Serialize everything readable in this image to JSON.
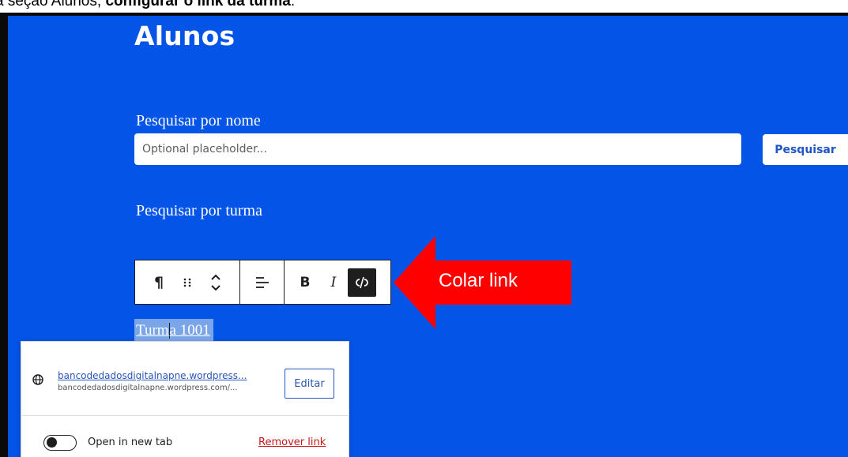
{
  "caption": {
    "prefix": "a seção Alunos, ",
    "bold": "configurar o link da turma",
    "suffix": "."
  },
  "page": {
    "heading": "Alunos",
    "search_label": "Pesquisar por nome",
    "search_placeholder": "Optional placeholder...",
    "search_button": "Pesquisar",
    "turma_label": "Pesquisar por turma"
  },
  "toolbar": {
    "paragraph_icon": "¶",
    "bold_label": "B",
    "italic_label": "I"
  },
  "annotation": {
    "label": "Colar link",
    "color": "#ff0000"
  },
  "selection": {
    "text_before_caret": "Turm",
    "text_after_caret": "a 1001"
  },
  "link_popover": {
    "url_display": "bancodedadosdigitalnapne.wordpress...",
    "url_sub": "bancodedadosdigitalnapne.wordpress.com/...",
    "edit_button": "Editar",
    "new_tab_label": "Open in new tab",
    "remove_link": "Remover link"
  },
  "colors": {
    "page_background": "#0454e8",
    "accent": "#2a56b8",
    "danger": "#cc1818"
  }
}
